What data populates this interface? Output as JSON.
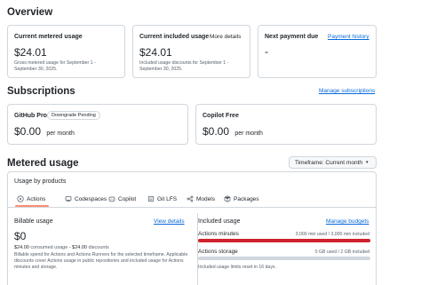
{
  "overview": {
    "title": "Overview",
    "current_metered": {
      "title": "Current metered usage",
      "amount": "$24.01",
      "note": "Gross metered usage for September 1 - September 30, 2025."
    },
    "current_included": {
      "title": "Current included usage",
      "link": "More details",
      "amount": "$24.01",
      "note": "Included usage discounts for September 1 - September 30, 2025."
    },
    "next_payment": {
      "title": "Next payment due",
      "link": "Payment history",
      "amount": "-"
    }
  },
  "subscriptions": {
    "title": "Subscriptions",
    "manage_link": "Manage subscriptions",
    "items": [
      {
        "name": "GitHub Pro",
        "badge": "Downgrade Pending",
        "price": "$0.00",
        "period": "per month"
      },
      {
        "name": "Copilot Free",
        "price": "$0.00",
        "period": "per month"
      }
    ]
  },
  "metered": {
    "title": "Metered usage",
    "timeframe": "Timeframe: Current month",
    "usage_by_products": "Usage by products",
    "tabs": [
      {
        "label": "Actions",
        "icon": "play-icon"
      },
      {
        "label": "Codespaces",
        "icon": "codespaces-icon"
      },
      {
        "label": "Copilot",
        "icon": "copilot-icon"
      },
      {
        "label": "Git LFS",
        "icon": "git-lfs-icon"
      },
      {
        "label": "Models",
        "icon": "models-icon"
      },
      {
        "label": "Packages",
        "icon": "package-icon"
      }
    ],
    "billable": {
      "title": "Billable usage",
      "link": "View details",
      "amount": "$0",
      "consumed_value": "$24.00",
      "consumed_label": "consumed usage",
      "minus": "-",
      "discounts_value": "$24.00",
      "discounts_label": "discounts",
      "note": "Billable spend for Actions and Actions Runners for the selected timeframe. Applicable discounts cover Actions usage in public repositories and included usage for Actions minutes and storage."
    },
    "included": {
      "title": "Included usage",
      "link": "Manage budgets",
      "minutes_label": "Actions minutes",
      "minutes_value": "3,000 min used / 3,000 min included",
      "minutes_fraction": 1.0,
      "storage_label": "Actions storage",
      "storage_value": "0 GB used / 2 GB included",
      "storage_fraction": 0.0,
      "reset_note": "Included usage limits reset in 16 days."
    }
  },
  "colors": {
    "accent": "#0969da",
    "danger": "#cf222e",
    "tab_underline": "#fd8c73"
  }
}
